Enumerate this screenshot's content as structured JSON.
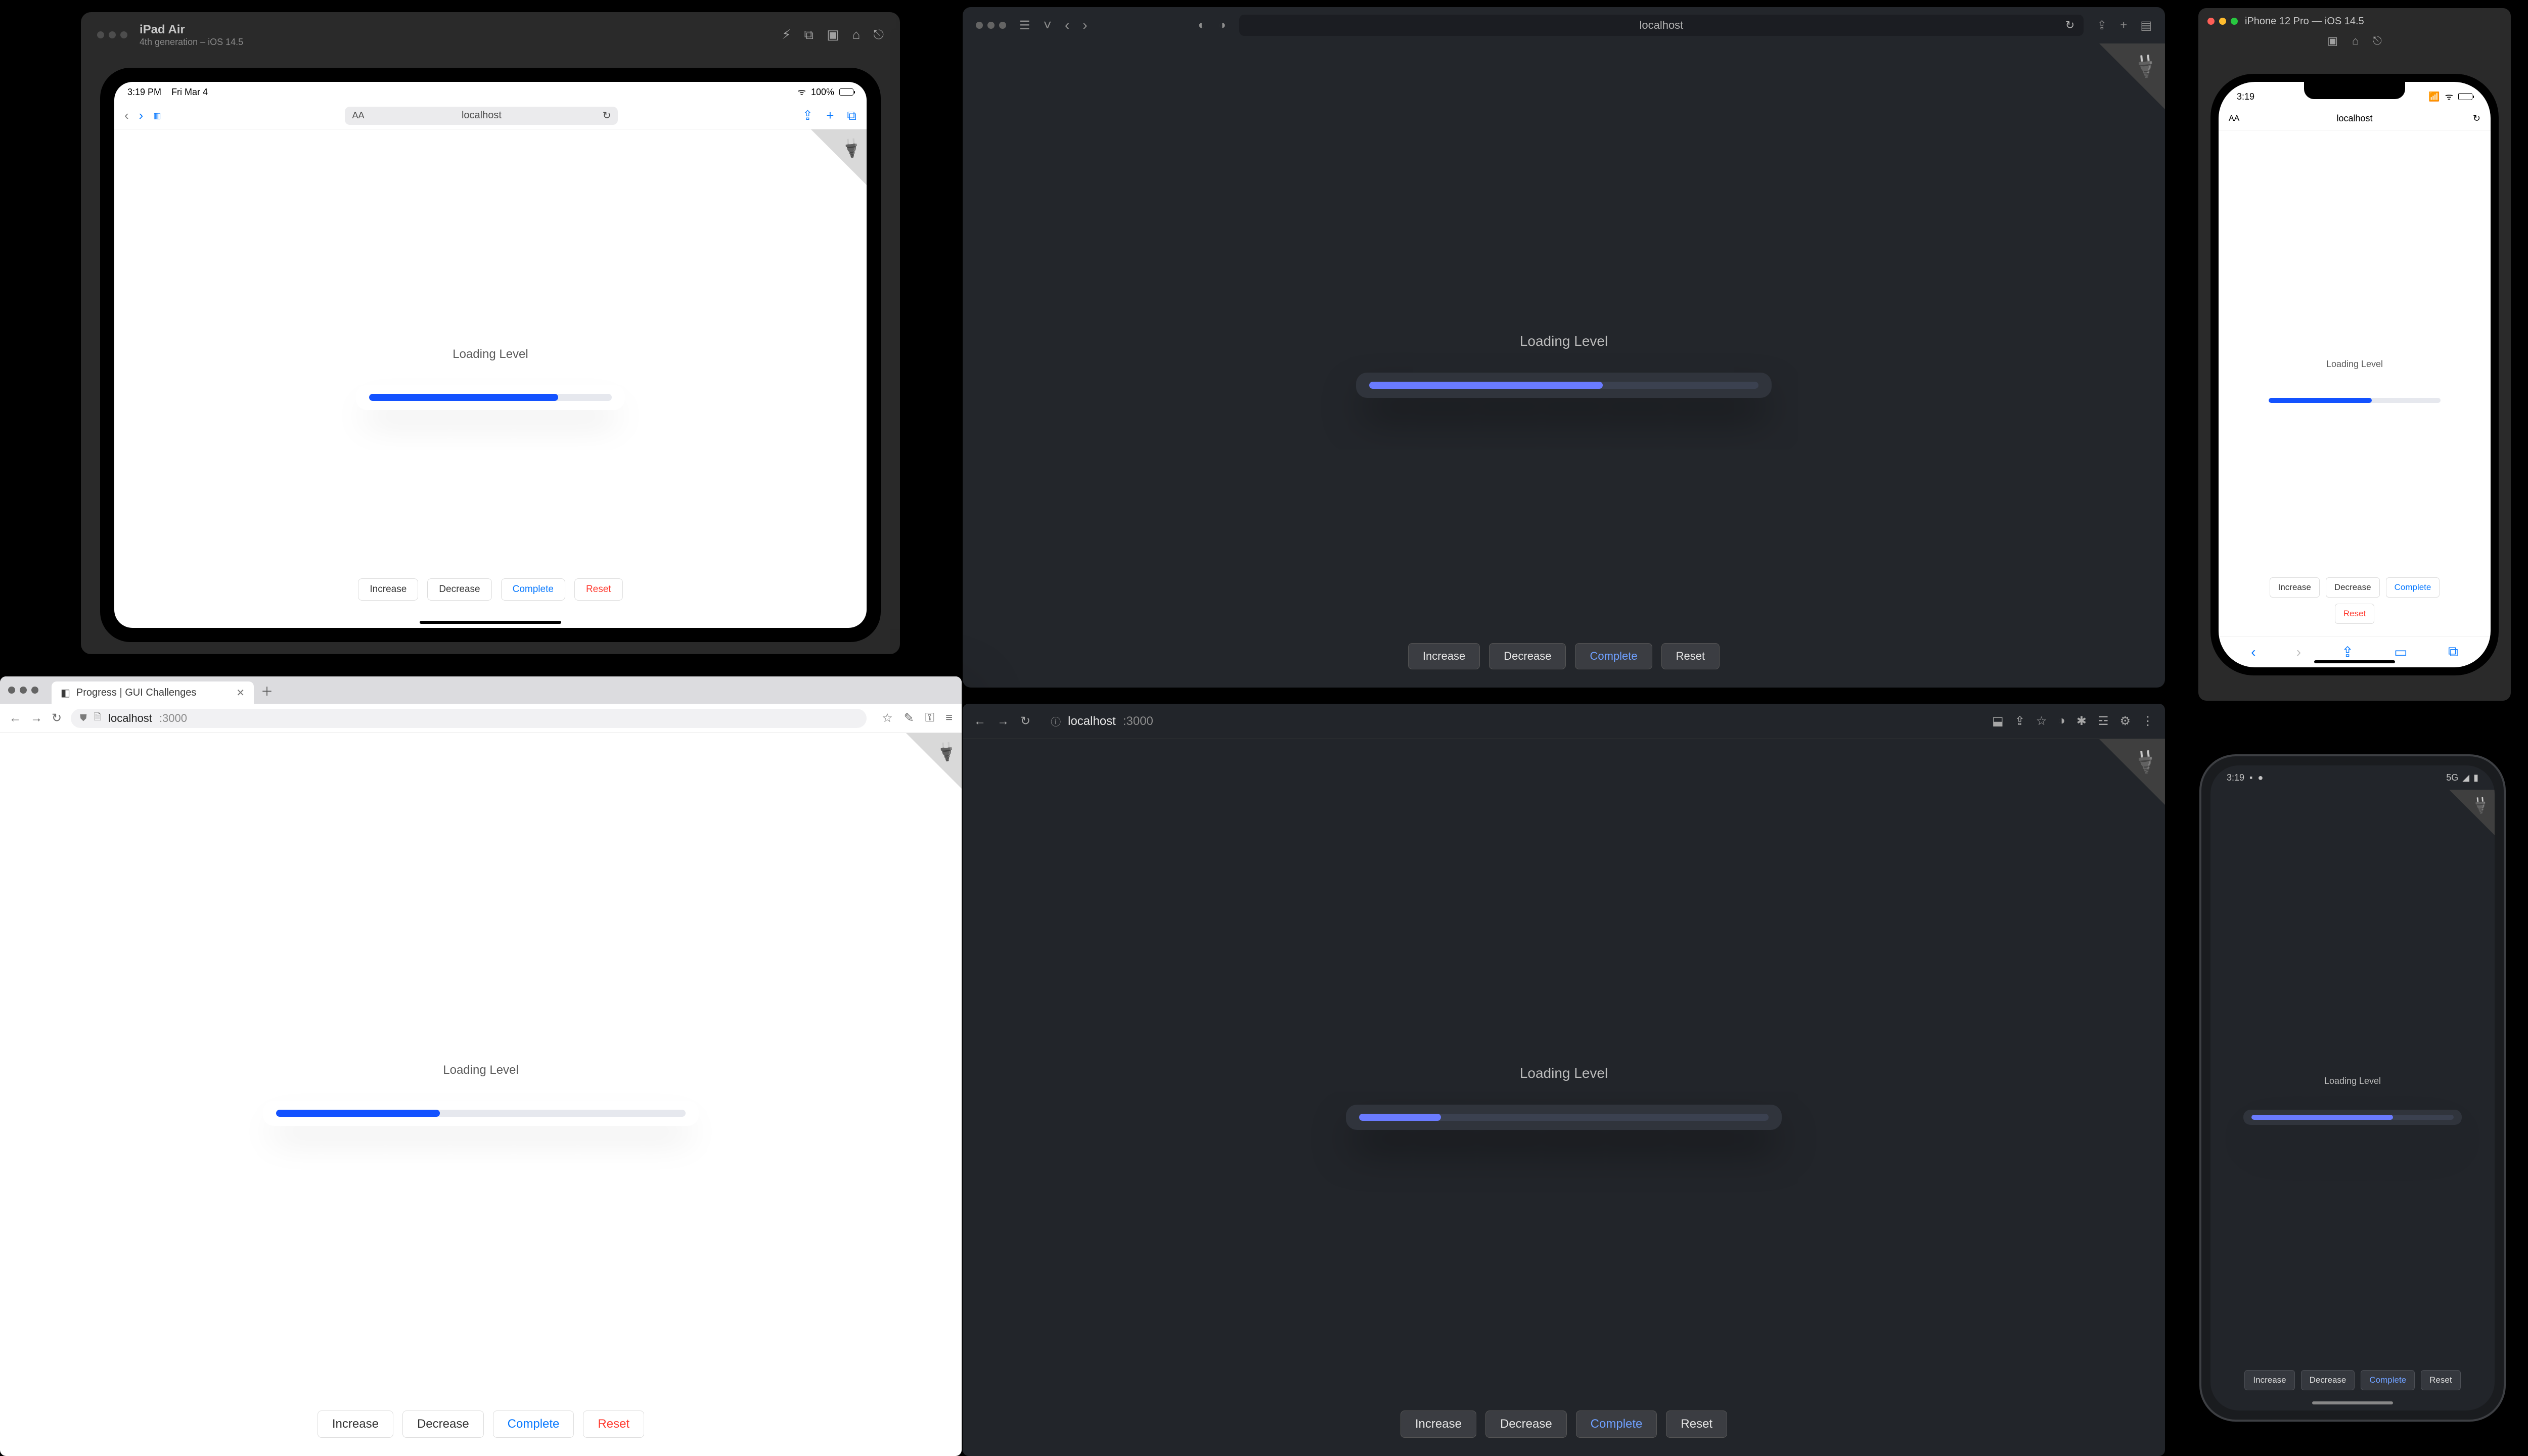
{
  "label": "Loading Level",
  "buttons": {
    "increase": "Increase",
    "decrease": "Decrease",
    "complete": "Complete",
    "reset": "Reset"
  },
  "host": "localhost",
  "port": ":3000",
  "ipad_sim": {
    "device": "iPad Air",
    "subtitle": "4th generation – iOS 14.5",
    "status_time": "3:19 PM",
    "status_date": "Fri Mar 4",
    "battery": "100%",
    "progress_pct": 78
  },
  "safari": {
    "progress_pct": 60
  },
  "iphone_sim": {
    "title": "iPhone 12 Pro — iOS 14.5",
    "time": "3:19",
    "progress_pct": 60
  },
  "chrome_light": {
    "tab_title": "Progress | GUI Challenges",
    "progress_pct": 40
  },
  "chrome_dark": {
    "progress_pct": 20
  },
  "android": {
    "time": "3:19",
    "net": "5G",
    "progress_pct": 70
  }
}
